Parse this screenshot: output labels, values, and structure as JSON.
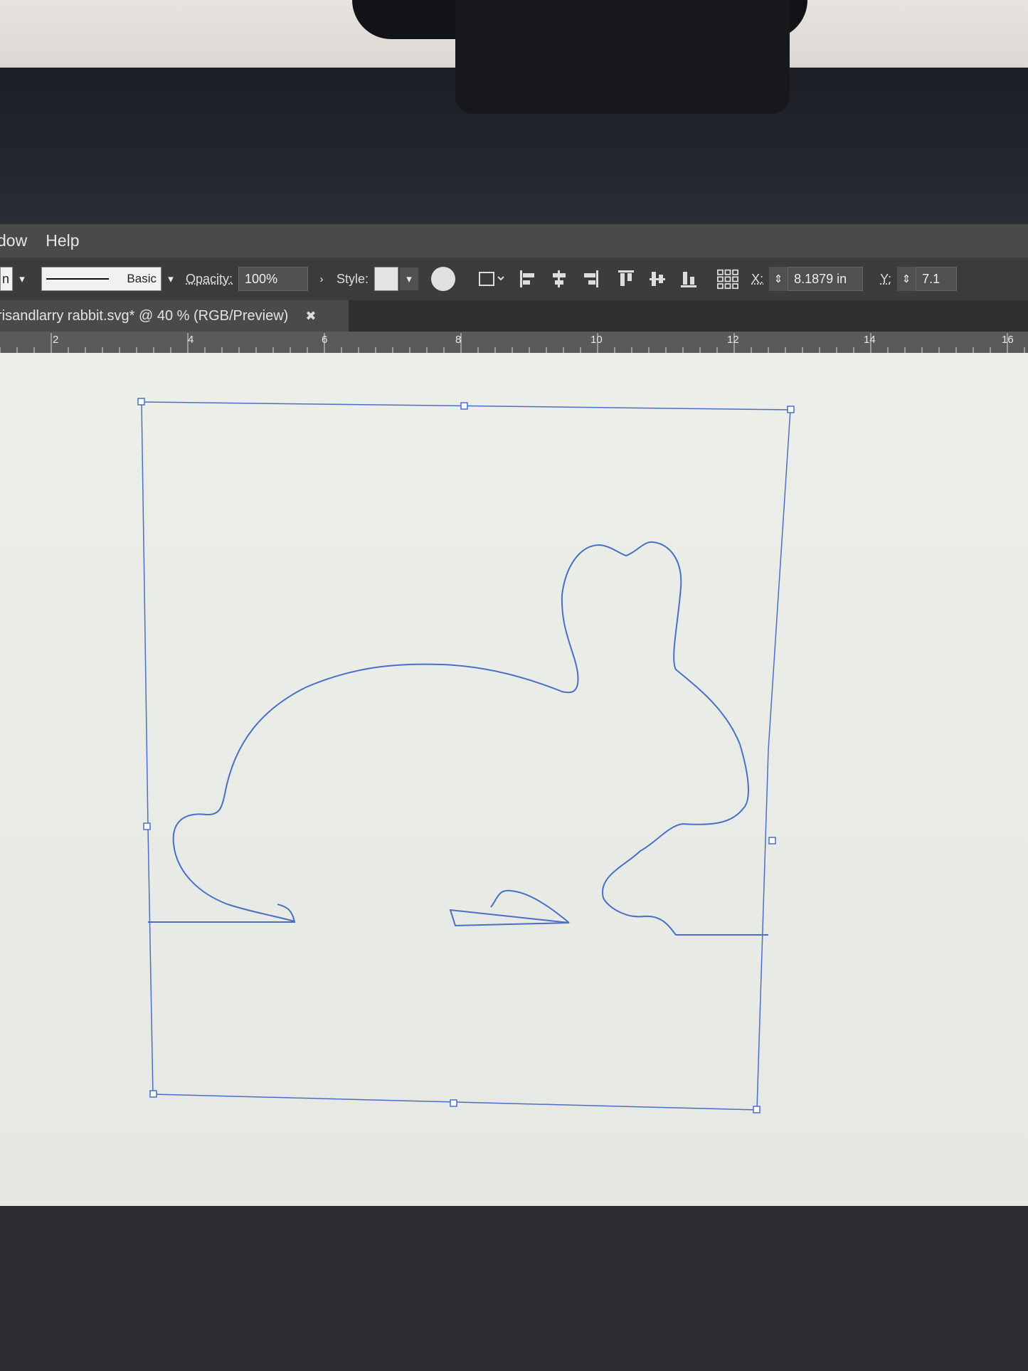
{
  "menu": {
    "items": [
      "dow",
      "Help"
    ]
  },
  "control_bar": {
    "left_stub": "n",
    "stroke_profile": "Basic",
    "opacity_label": "Opacity:",
    "opacity_value": "100%",
    "style_label": "Style:",
    "x_label": "X:",
    "x_value": "8.1879 in",
    "y_label": "Y:",
    "y_value": "7.1"
  },
  "document_tab": {
    "title": "risandlarry rabbit.svg* @ 40 % (RGB/Preview)",
    "close_glyph": "✖"
  },
  "ruler": {
    "labels": [
      "2",
      "4",
      "6",
      "8",
      "10",
      "12",
      "14",
      "16"
    ]
  },
  "colors": {
    "path_stroke": "#4a6fc4",
    "menubar_bg": "#4a4a4a",
    "controlbar_bg": "#3c3c3c",
    "canvas_bg": "#eceee9"
  }
}
